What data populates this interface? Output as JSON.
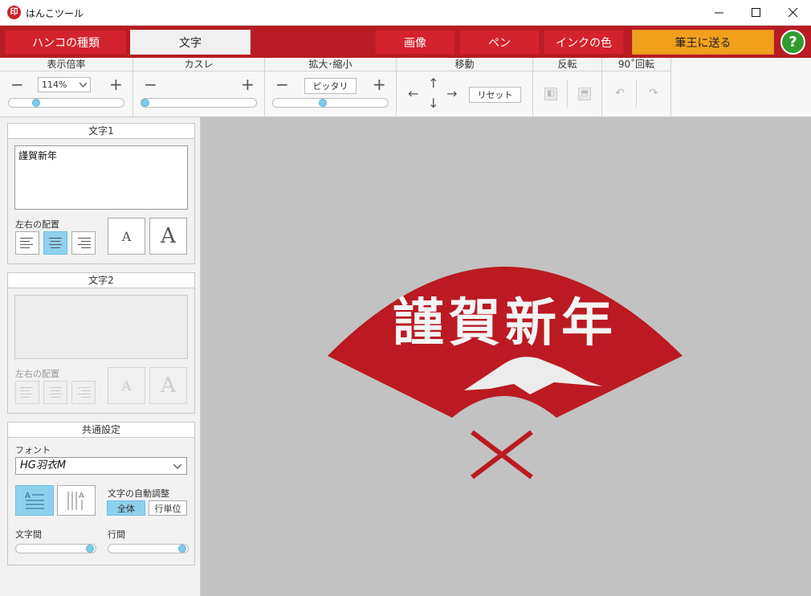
{
  "window": {
    "icon_text": "印",
    "title": "はんこツール",
    "minimize_icon": "minimize-icon",
    "maximize_icon": "maximize-icon",
    "close_icon": "close-icon"
  },
  "topbar": {
    "tabs": [
      {
        "label": "ハンコの種類",
        "active": false
      },
      {
        "label": "文字",
        "active": true
      }
    ],
    "image_label": "画像",
    "pen_label": "ペン",
    "ink_label": "インクの色",
    "send_label": "筆王に送る",
    "help_label": "?",
    "accent": "#b81c24",
    "send_color": "#f1a01e",
    "help_color": "#2f9d2f"
  },
  "adjust": {
    "zoom": {
      "label": "表示倍率",
      "value": "114%",
      "minus": "−",
      "plus": "+",
      "slider": 0.22
    },
    "blur": {
      "label": "カスレ",
      "minus": "−",
      "plus": "+",
      "slider": 0.0
    },
    "scale": {
      "label": "拡大･縮小",
      "fit_label": "ピッタリ",
      "minus": "−",
      "plus": "+",
      "slider": 0.43
    },
    "move": {
      "label": "移動",
      "reset_label": "リセット",
      "up": "↑",
      "down": "↓",
      "left": "←",
      "right": "→"
    },
    "flip": {
      "label": "反転"
    },
    "rotate": {
      "label": "90˚回転"
    }
  },
  "text1": {
    "header": "文字1",
    "value": "謹賀新年",
    "align_label": "左右の配置",
    "align_selected": "center",
    "size_small": "A",
    "size_large": "A"
  },
  "text2": {
    "header": "文字2",
    "value": "",
    "align_label": "左右の配置",
    "size_small": "A",
    "size_large": "A"
  },
  "common": {
    "header": "共通設定",
    "font_label": "フォント",
    "font_value": "HG羽衣M",
    "auto_adjust_label": "文字の自動調整",
    "auto_all": "全体",
    "auto_line": "行単位",
    "char_spacing_label": "文字間",
    "line_spacing_label": "行間",
    "char_spacing": 0.98,
    "line_spacing": 0.98
  },
  "canvas": {
    "stamp_text": "謹賀新年",
    "stamp_color": "#bb1a22",
    "background": "#c2c2c2"
  }
}
